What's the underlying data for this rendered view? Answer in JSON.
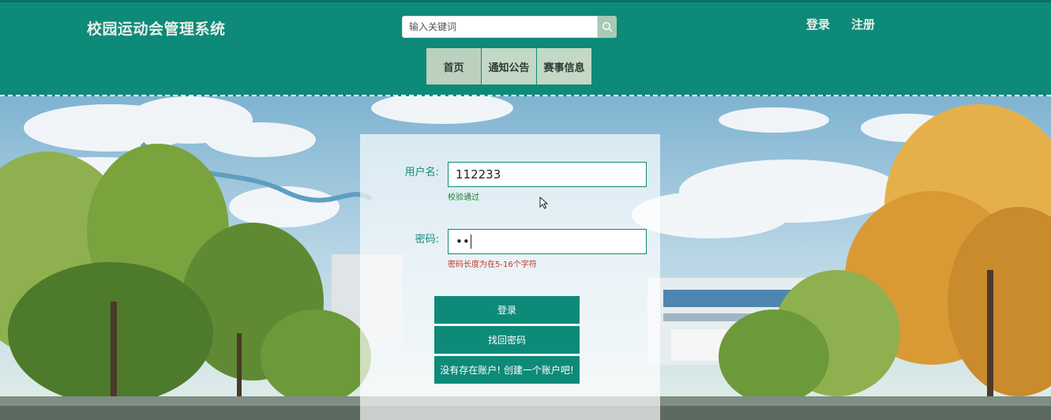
{
  "header": {
    "site_title": "校园运动会管理系统",
    "search_placeholder": "输入关键词",
    "auth": {
      "login": "登录",
      "register": "注册"
    },
    "nav": [
      {
        "label": "首页"
      },
      {
        "label": "通知公告"
      },
      {
        "label": "赛事信息"
      }
    ]
  },
  "login_form": {
    "username_label": "用户名:",
    "username_value": "112233",
    "username_hint": "校验通过",
    "password_label": "密码:",
    "password_value": "••",
    "password_hint": "密码长度为在5-16个字符",
    "login_button": "登录",
    "forgot_button": "找回密码",
    "register_button": "没有存在账户! 创建一个账户吧!"
  },
  "colors": {
    "header_bg": "#0e8a79",
    "nav_bg": "#c4d8c6",
    "button_bg": "#0e8a79",
    "label_color": "#138a78",
    "hint_ok": "#1d7a2a",
    "hint_error": "#c0392b"
  },
  "icons": {
    "search": "search-icon"
  }
}
